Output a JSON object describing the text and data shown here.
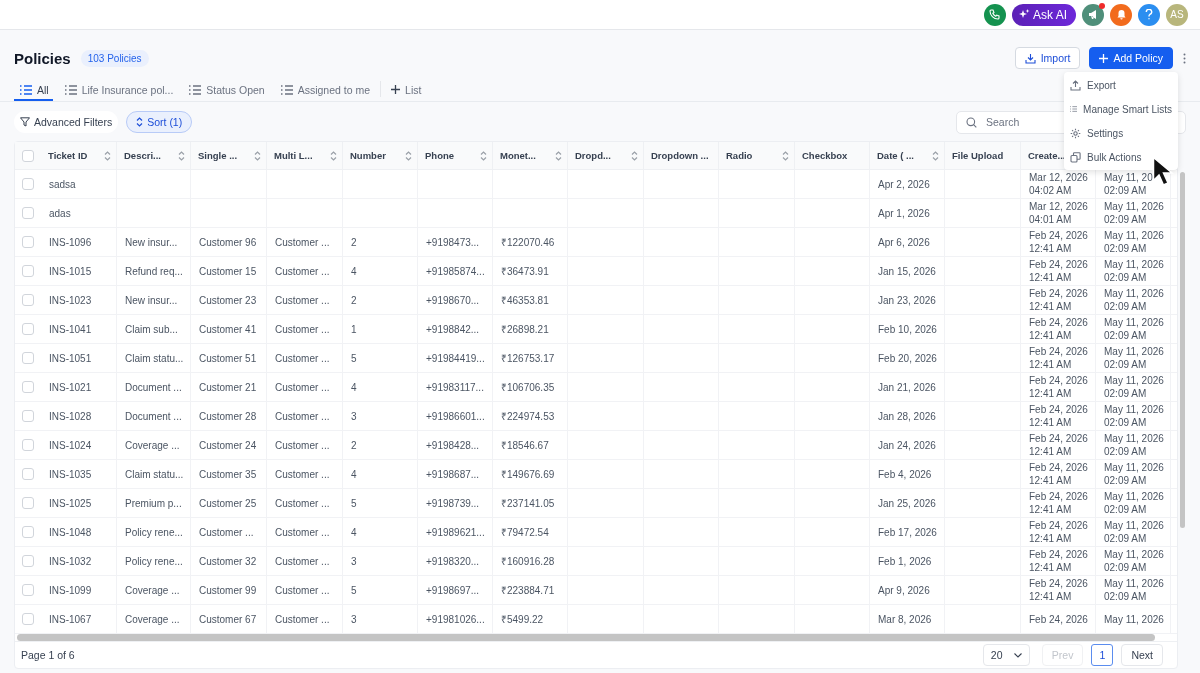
{
  "topbar": {
    "ask_ai": "Ask AI",
    "avatar": "AS",
    "megaphone_alert": true
  },
  "header": {
    "title": "Policies",
    "count": "103 Policies",
    "import": "Import",
    "add": "Add Policy"
  },
  "tabs": [
    {
      "label": "All",
      "selected": true
    },
    {
      "label": "Life Insurance pol...",
      "selected": false
    },
    {
      "label": "Status Open",
      "selected": false
    },
    {
      "label": "Assigned to me",
      "selected": false
    }
  ],
  "add_list": "List",
  "filters": {
    "advanced": "Advanced Filters",
    "sort": "Sort (1)",
    "sort_active": true,
    "search": {
      "placeholder": "Search"
    }
  },
  "menu": {
    "items": [
      {
        "label": "Export",
        "kind": "export"
      },
      {
        "label": "Manage Smart Lists",
        "kind": "list"
      },
      {
        "label": "Settings",
        "kind": "settings"
      },
      {
        "label": "Bulk Actions",
        "kind": "copy"
      }
    ]
  },
  "table": {
    "header_checked": false,
    "columns": [
      {
        "label": "Ticket ID",
        "sortable": true
      },
      {
        "label": "Descri...",
        "sortable": true
      },
      {
        "label": "Single ...",
        "sortable": true
      },
      {
        "label": "Multi L...",
        "sortable": true
      },
      {
        "label": "Number",
        "sortable": true
      },
      {
        "label": "Phone",
        "sortable": true
      },
      {
        "label": "Monet...",
        "sortable": true
      },
      {
        "label": "Dropd...",
        "sortable": true
      },
      {
        "label": "Dropdown ...",
        "sortable": false
      },
      {
        "label": "Radio",
        "sortable": true
      },
      {
        "label": "Checkbox",
        "sortable": false
      },
      {
        "label": "Date ( ...",
        "sortable": true
      },
      {
        "label": "File Upload",
        "sortable": false
      },
      {
        "label": "Create...",
        "sortable": false
      },
      {}
    ],
    "rows": [
      {
        "checked": false,
        "cells": [
          "sadsa",
          null,
          null,
          null,
          null,
          null,
          null,
          null,
          null,
          null,
          null,
          "Apr 2, 2026",
          null,
          [
            "Mar 12, 2026",
            "04:02 AM"
          ],
          [
            "May 11, 20",
            "02:09 AM"
          ]
        ]
      },
      {
        "checked": false,
        "cells": [
          "adas",
          null,
          null,
          null,
          null,
          null,
          null,
          null,
          null,
          null,
          null,
          "Apr 1, 2026",
          null,
          [
            "Mar 12, 2026",
            "04:01 AM"
          ],
          [
            "May 11, 2026",
            "02:09 AM"
          ]
        ]
      },
      {
        "checked": false,
        "cells": [
          "INS-1096",
          "New insur...",
          "Customer 96",
          "Customer ...",
          "2",
          "+9198473...",
          "₹122070.46",
          null,
          null,
          null,
          null,
          "Apr 6, 2026",
          null,
          [
            "Feb 24, 2026",
            "12:41 AM"
          ],
          [
            "May 11, 2026",
            "02:09 AM"
          ]
        ]
      },
      {
        "checked": false,
        "cells": [
          "INS-1015",
          "Refund req...",
          "Customer 15",
          "Customer ...",
          "4",
          "+91985874...",
          "₹36473.91",
          null,
          null,
          null,
          null,
          "Jan 15, 2026",
          null,
          [
            "Feb 24, 2026",
            "12:41 AM"
          ],
          [
            "May 11, 2026",
            "02:09 AM"
          ]
        ]
      },
      {
        "checked": false,
        "cells": [
          "INS-1023",
          "New insur...",
          "Customer 23",
          "Customer ...",
          "2",
          "+9198670...",
          "₹46353.81",
          null,
          null,
          null,
          null,
          "Jan 23, 2026",
          null,
          [
            "Feb 24, 2026",
            "12:41 AM"
          ],
          [
            "May 11, 2026",
            "02:09 AM"
          ]
        ]
      },
      {
        "checked": false,
        "cells": [
          "INS-1041",
          "Claim sub...",
          "Customer 41",
          "Customer ...",
          "1",
          "+9198842...",
          "₹26898.21",
          null,
          null,
          null,
          null,
          "Feb 10, 2026",
          null,
          [
            "Feb 24, 2026",
            "12:41 AM"
          ],
          [
            "May 11, 2026",
            "02:09 AM"
          ]
        ]
      },
      {
        "checked": false,
        "cells": [
          "INS-1051",
          "Claim statu...",
          "Customer 51",
          "Customer ...",
          "5",
          "+91984419...",
          "₹126753.17",
          null,
          null,
          null,
          null,
          "Feb 20, 2026",
          null,
          [
            "Feb 24, 2026",
            "12:41 AM"
          ],
          [
            "May 11, 2026",
            "02:09 AM"
          ]
        ]
      },
      {
        "checked": false,
        "cells": [
          "INS-1021",
          "Document ...",
          "Customer 21",
          "Customer ...",
          "4",
          "+91983117...",
          "₹106706.35",
          null,
          null,
          null,
          null,
          "Jan 21, 2026",
          null,
          [
            "Feb 24, 2026",
            "12:41 AM"
          ],
          [
            "May 11, 2026",
            "02:09 AM"
          ]
        ]
      },
      {
        "checked": false,
        "cells": [
          "INS-1028",
          "Document ...",
          "Customer 28",
          "Customer ...",
          "3",
          "+91986601...",
          "₹224974.53",
          null,
          null,
          null,
          null,
          "Jan 28, 2026",
          null,
          [
            "Feb 24, 2026",
            "12:41 AM"
          ],
          [
            "May 11, 2026",
            "02:09 AM"
          ]
        ]
      },
      {
        "checked": false,
        "cells": [
          "INS-1024",
          "Coverage ...",
          "Customer 24",
          "Customer ...",
          "2",
          "+9198428...",
          "₹18546.67",
          null,
          null,
          null,
          null,
          "Jan 24, 2026",
          null,
          [
            "Feb 24, 2026",
            "12:41 AM"
          ],
          [
            "May 11, 2026",
            "02:09 AM"
          ]
        ]
      },
      {
        "checked": false,
        "cells": [
          "INS-1035",
          "Claim statu...",
          "Customer 35",
          "Customer ...",
          "4",
          "+9198687...",
          "₹149676.69",
          null,
          null,
          null,
          null,
          "Feb 4, 2026",
          null,
          [
            "Feb 24, 2026",
            "12:41 AM"
          ],
          [
            "May 11, 2026",
            "02:09 AM"
          ]
        ]
      },
      {
        "checked": false,
        "cells": [
          "INS-1025",
          "Premium p...",
          "Customer 25",
          "Customer ...",
          "5",
          "+9198739...",
          "₹237141.05",
          null,
          null,
          null,
          null,
          "Jan 25, 2026",
          null,
          [
            "Feb 24, 2026",
            "12:41 AM"
          ],
          [
            "May 11, 2026",
            "02:09 AM"
          ]
        ]
      },
      {
        "checked": false,
        "cells": [
          "INS-1048",
          "Policy rene...",
          "Customer ...",
          "Customer ...",
          "4",
          "+91989621...",
          "₹79472.54",
          null,
          null,
          null,
          null,
          "Feb 17, 2026",
          null,
          [
            "Feb 24, 2026",
            "12:41 AM"
          ],
          [
            "May 11, 2026",
            "02:09 AM"
          ]
        ]
      },
      {
        "checked": false,
        "cells": [
          "INS-1032",
          "Policy rene...",
          "Customer 32",
          "Customer ...",
          "3",
          "+9198320...",
          "₹160916.28",
          null,
          null,
          null,
          null,
          "Feb 1, 2026",
          null,
          [
            "Feb 24, 2026",
            "12:41 AM"
          ],
          [
            "May 11, 2026",
            "02:09 AM"
          ]
        ]
      },
      {
        "checked": false,
        "cells": [
          "INS-1099",
          "Coverage ...",
          "Customer 99",
          "Customer ...",
          "5",
          "+9198697...",
          "₹223884.71",
          null,
          null,
          null,
          null,
          "Apr 9, 2026",
          null,
          [
            "Feb 24, 2026",
            "12:41 AM"
          ],
          [
            "May 11, 2026",
            "02:09 AM"
          ]
        ]
      },
      {
        "checked": false,
        "cells": [
          "INS-1067",
          "Coverage ...",
          "Customer 67",
          "Customer ...",
          "3",
          "+91981026...",
          "₹5499.22",
          null,
          null,
          null,
          null,
          "Mar 8, 2026",
          null,
          [
            "Feb 24, 2026"
          ],
          [
            "May 11, 2026"
          ]
        ]
      }
    ]
  },
  "pagination": {
    "summary": "Page 1 of 6",
    "page_size": "20",
    "prev": {
      "label": "Prev",
      "disabled": true
    },
    "pages": [
      {
        "label": "1",
        "selected": true
      }
    ],
    "next": {
      "label": "Next",
      "disabled": false
    }
  }
}
